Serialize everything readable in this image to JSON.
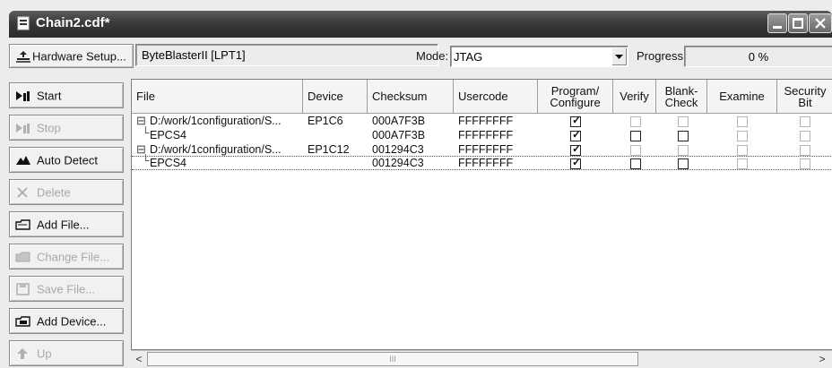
{
  "window": {
    "title": "Chain2.cdf*",
    "controls": [
      "minimize-icon",
      "maximize-icon",
      "close-icon"
    ]
  },
  "toolbar": {
    "hardware_setup_label": "Hardware Setup...",
    "hardware_value": "ByteBlasterII [LPT1]",
    "mode_label": "Mode:",
    "mode_value": "JTAG",
    "progress_label": "Progress:",
    "progress_value": "0 %"
  },
  "sidebar": {
    "buttons": [
      {
        "label": "Start",
        "enabled": true,
        "icon": "start-icon"
      },
      {
        "label": "Stop",
        "enabled": false,
        "icon": "stop-icon"
      },
      {
        "label": "Auto Detect",
        "enabled": true,
        "icon": "auto-detect-icon"
      },
      {
        "label": "Delete",
        "enabled": false,
        "icon": "delete-x-icon"
      },
      {
        "label": "Add File...",
        "enabled": true,
        "icon": "add-file-icon"
      },
      {
        "label": "Change File...",
        "enabled": false,
        "icon": "change-file-icon"
      },
      {
        "label": "Save File...",
        "enabled": false,
        "icon": "save-file-icon"
      },
      {
        "label": "Add Device...",
        "enabled": true,
        "icon": "add-device-icon"
      },
      {
        "label": "Up",
        "enabled": false,
        "icon": "up-icon"
      }
    ]
  },
  "table": {
    "columns": [
      "File",
      "Device",
      "Checksum",
      "Usercode",
      "Program/\nConfigure",
      "Verify",
      "Blank-\nCheck",
      "Examine",
      "Security\nBit"
    ],
    "rows": [
      {
        "file": "D:/work/1configuration/S...",
        "device": "EP1C6",
        "checksum": "000A7F3B",
        "usercode": "FFFFFFFF",
        "tree": "⊟",
        "program": true,
        "verify": false,
        "blank": false,
        "examine": false,
        "security": false,
        "verify_enabled": true,
        "blank_enabled": true
      },
      {
        "file": "EPCS4",
        "device": "",
        "checksum": "000A7F3B",
        "usercode": "FFFFFFFF",
        "tree": "└",
        "program": true,
        "verify": false,
        "blank": false,
        "examine": false,
        "security": false,
        "verify_enabled": true,
        "blank_enabled": true
      },
      {
        "file": "D:/work/1configuration/S...",
        "device": "EP1C12",
        "checksum": "001294C3",
        "usercode": "FFFFFFFF",
        "tree": "⊟",
        "program": true,
        "verify": false,
        "blank": false,
        "examine": false,
        "security": false,
        "verify_enabled": false,
        "blank_enabled": false
      },
      {
        "file": "EPCS4",
        "device": "",
        "checksum": "001294C3",
        "usercode": "FFFFFFFF",
        "tree": "└",
        "program": true,
        "verify": false,
        "blank": false,
        "examine": false,
        "security": false,
        "verify_enabled": true,
        "blank_enabled": true
      }
    ]
  },
  "scrollbar": {
    "left_arrow": "<",
    "right_arrow": ">",
    "thumb_grip": "III"
  }
}
